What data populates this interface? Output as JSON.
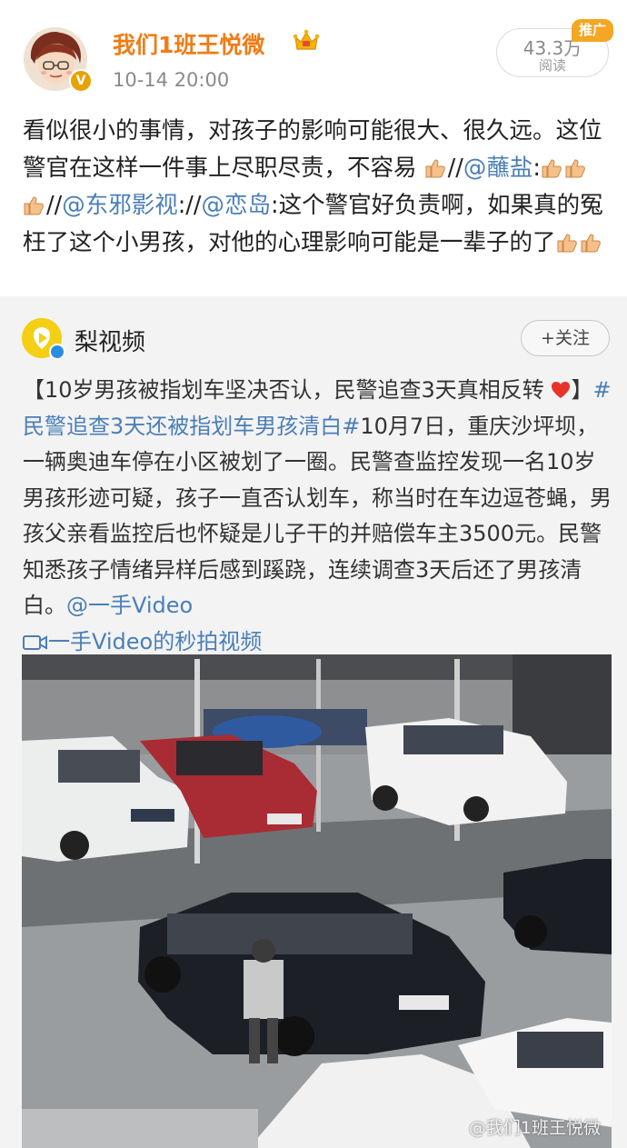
{
  "post": {
    "username": "我们1班王悦微",
    "timestamp": "10-14 20:00",
    "views_count": "43.3万",
    "views_label": "阅读",
    "promo_badge": "推广",
    "text_line1": "看似很小的事情，对孩子的影响可能很大、很久远。这位警官在这样一件事上尽职尽责，不容易",
    "sep1": "//",
    "mention1": "@蘸盐",
    "colon1": ":",
    "sep2": "//",
    "mention2": "@东邪影视",
    "colon2": "://",
    "mention3": "@恋岛",
    "text_tail": ":这个警官好负责啊，如果真的冤枉了这个小男孩，对他的心理影响可能是一辈子的了"
  },
  "repost": {
    "source_name": "梨视频",
    "follow_label": "+关注",
    "headline": "【10岁男孩被指划车坚决否认，民警追查3天真相反转",
    "bracket_close": "】",
    "hashtag": "#民警追查3天还被指划车男孩清白#",
    "body": "10月7日，重庆沙坪坝，一辆奥迪车停在小区被划了一圈。民警查监控发现一名10岁男孩形迹可疑，孩子一直否认划车，称当时在车边逗苍蝇，男孩父亲看监控后也怀疑是儿子干的并赔偿车主3500元。民警知悉孩子情绪异样后感到蹊跷，连续调查3天后还了男孩清白。",
    "mention": "@一手Video",
    "video_link": "一手Video的秒拍视频",
    "watermark": "@我们1班王悦微"
  },
  "colors": {
    "username": "#f07c16",
    "link": "#4a7fb8",
    "promo": "#f5a623",
    "repost_bg": "#f3f3f3"
  }
}
